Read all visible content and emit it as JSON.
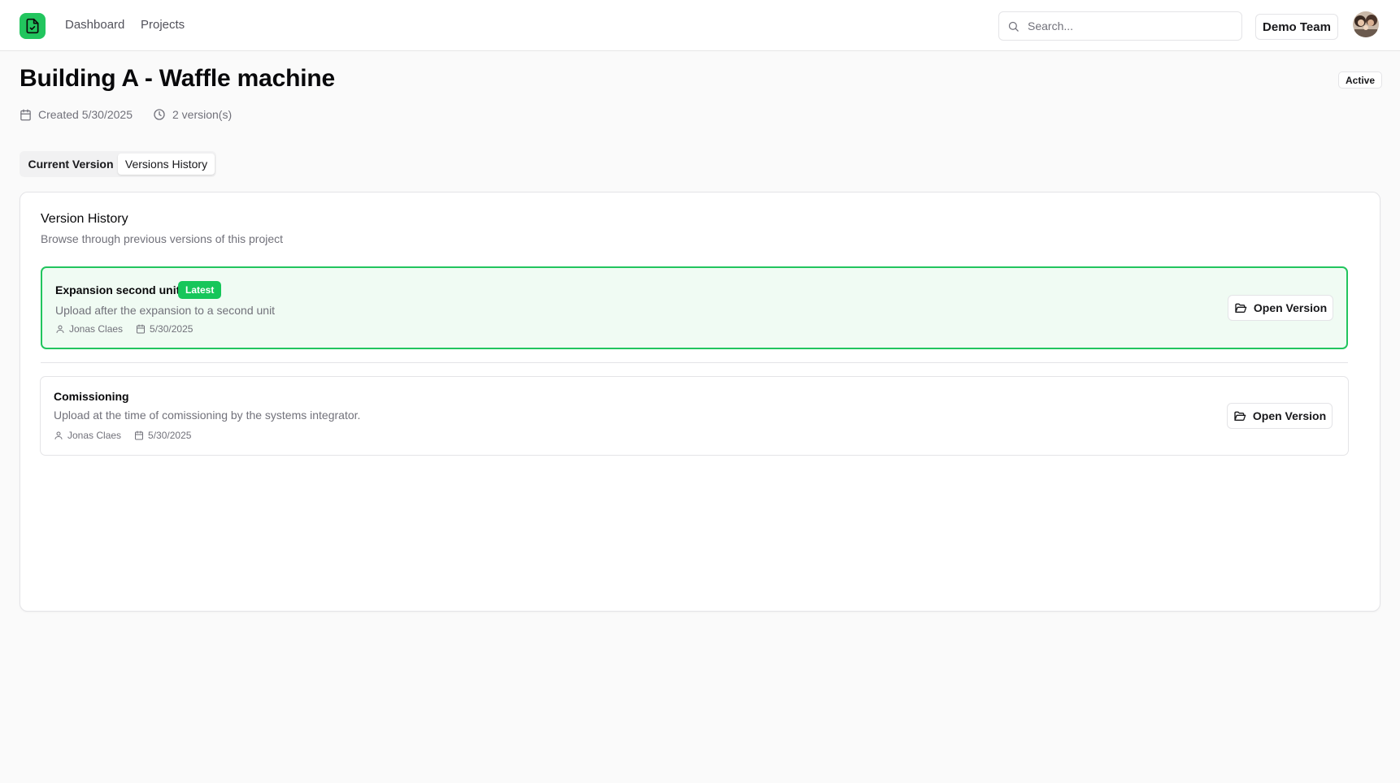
{
  "header": {
    "nav": [
      {
        "label": "Dashboard"
      },
      {
        "label": "Projects"
      }
    ],
    "search": {
      "placeholder": "Search..."
    },
    "team_label": "Demo Team"
  },
  "project": {
    "title": "Building A - Waffle machine",
    "status": "Active",
    "created": "Created 5/30/2025",
    "versions_count": "2 version(s)"
  },
  "tabs": [
    {
      "label": "Current Version",
      "active": false
    },
    {
      "label": "Versions History",
      "active": true
    }
  ],
  "history": {
    "title": "Version History",
    "description": "Browse through previous versions of this project",
    "versions": [
      {
        "name": "Expansion second unit",
        "badge": "Latest",
        "description": "Upload after the expansion to a second unit",
        "author": "Jonas Claes",
        "date": "5/30/2025",
        "action": "Open Version"
      },
      {
        "name": "Comissioning",
        "description": "Upload at the time of comissioning by the systems integrator.",
        "author": "Jonas Claes",
        "date": "5/30/2025",
        "action": "Open Version"
      }
    ]
  },
  "colors": {
    "accent": "#22c55e",
    "latest_bg": "#f0fbf3",
    "badge": "#16c65a"
  }
}
